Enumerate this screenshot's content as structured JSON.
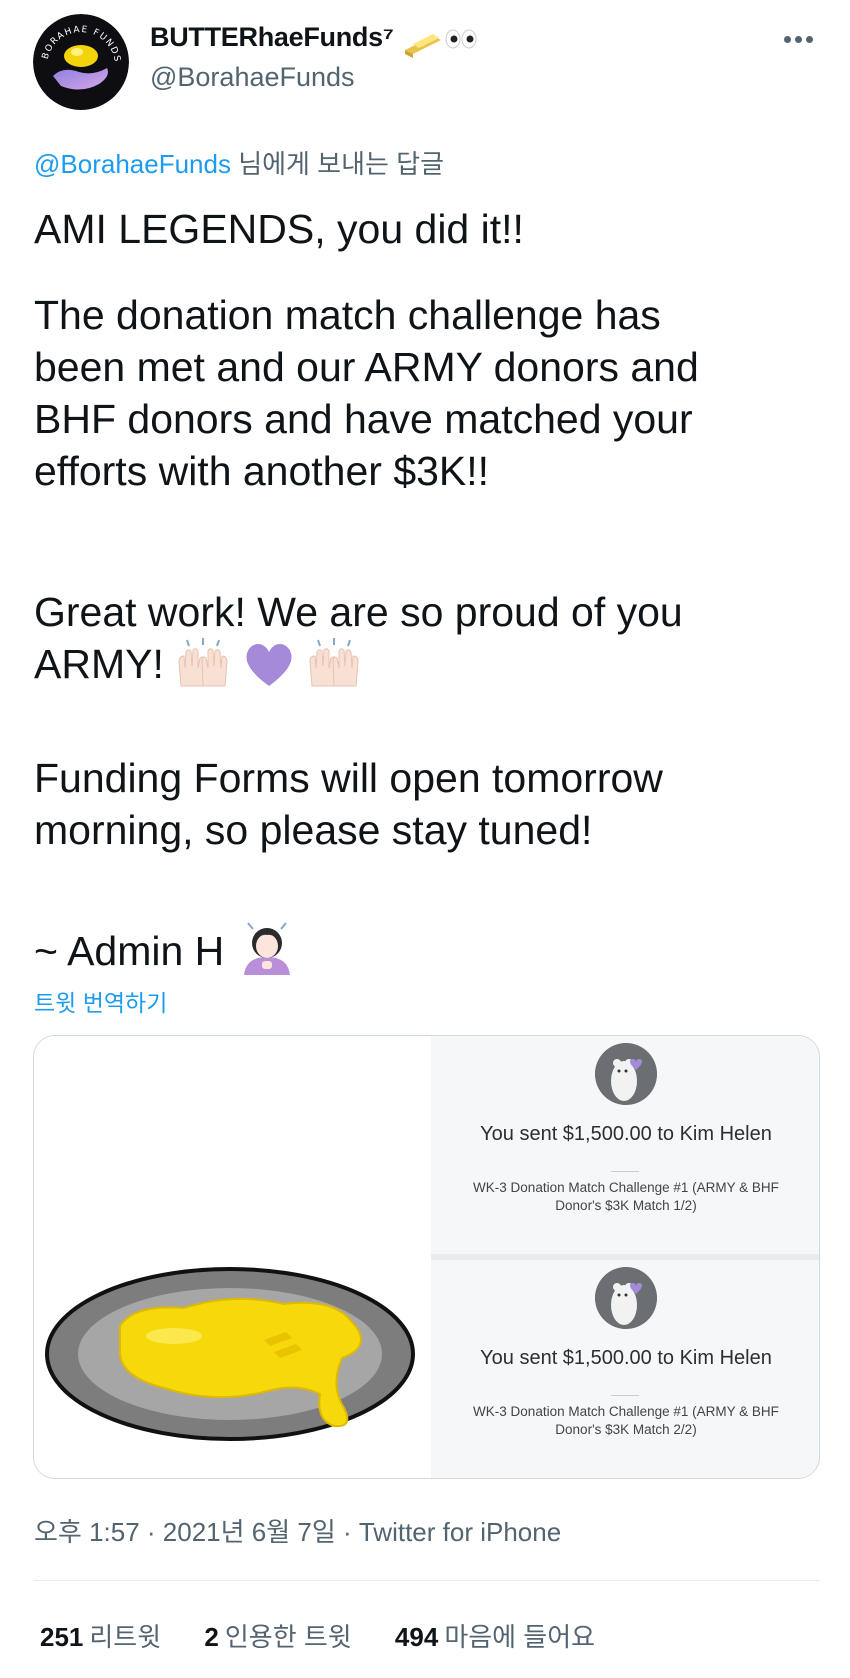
{
  "author": {
    "display_name": "BUTTERhaeFunds⁷",
    "handle": "@BorahaeFunds",
    "avatar_text": "BORAHAE FUNDS",
    "name_emojis": [
      "butter-emoji",
      "eyes-emoji"
    ]
  },
  "reply": {
    "mention": "@BorahaeFunds",
    "suffix": " 님에게 보내는 답글"
  },
  "tweet": {
    "line1": "AMI LEGENDS, you did it!!",
    "line2": "The donation match challenge has",
    "line3": "been met and our ARMY donors and",
    "line4": "BHF donors and have matched your",
    "line5": "efforts with another $3K!!",
    "line6": "Great work! We are so proud of you",
    "line7": "ARMY!",
    "line8": "Funding Forms will open tomorrow",
    "line9": "morning, so please stay tuned!",
    "line10": "~ Admin H",
    "emojis": [
      "raising-hands-emoji",
      "purple-heart-emoji",
      "raising-hands-emoji",
      "person-emoji"
    ]
  },
  "translate_label": "트윗 번역하기",
  "media": {
    "left_image": "butter-plate-image",
    "payments": [
      {
        "title": "You sent $1,500.00 to Kim Helen",
        "note_line1": "WK-3 Donation Match Challenge #1 (ARMY & BHF",
        "note_line2": "Donor's $3K Match 1/2)"
      },
      {
        "title": "You sent $1,500.00 to Kim Helen",
        "note_line1": "WK-3 Donation Match Challenge #1 (ARMY & BHF",
        "note_line2": "Donor's $3K Match 2/2)"
      }
    ]
  },
  "meta": "오후 1:57 · 2021년 6월 7일 · Twitter for iPhone",
  "stats": {
    "retweets": {
      "count": "251",
      "label": "리트윗"
    },
    "quotes": {
      "count": "2",
      "label": "인용한 트윗"
    },
    "likes": {
      "count": "494",
      "label": "마음에 들어요"
    }
  },
  "colors": {
    "link": "#1d9bf0",
    "muted": "#536471",
    "text": "#0f1419",
    "butter": "#f5d90a",
    "purple": "#a58ad9"
  }
}
